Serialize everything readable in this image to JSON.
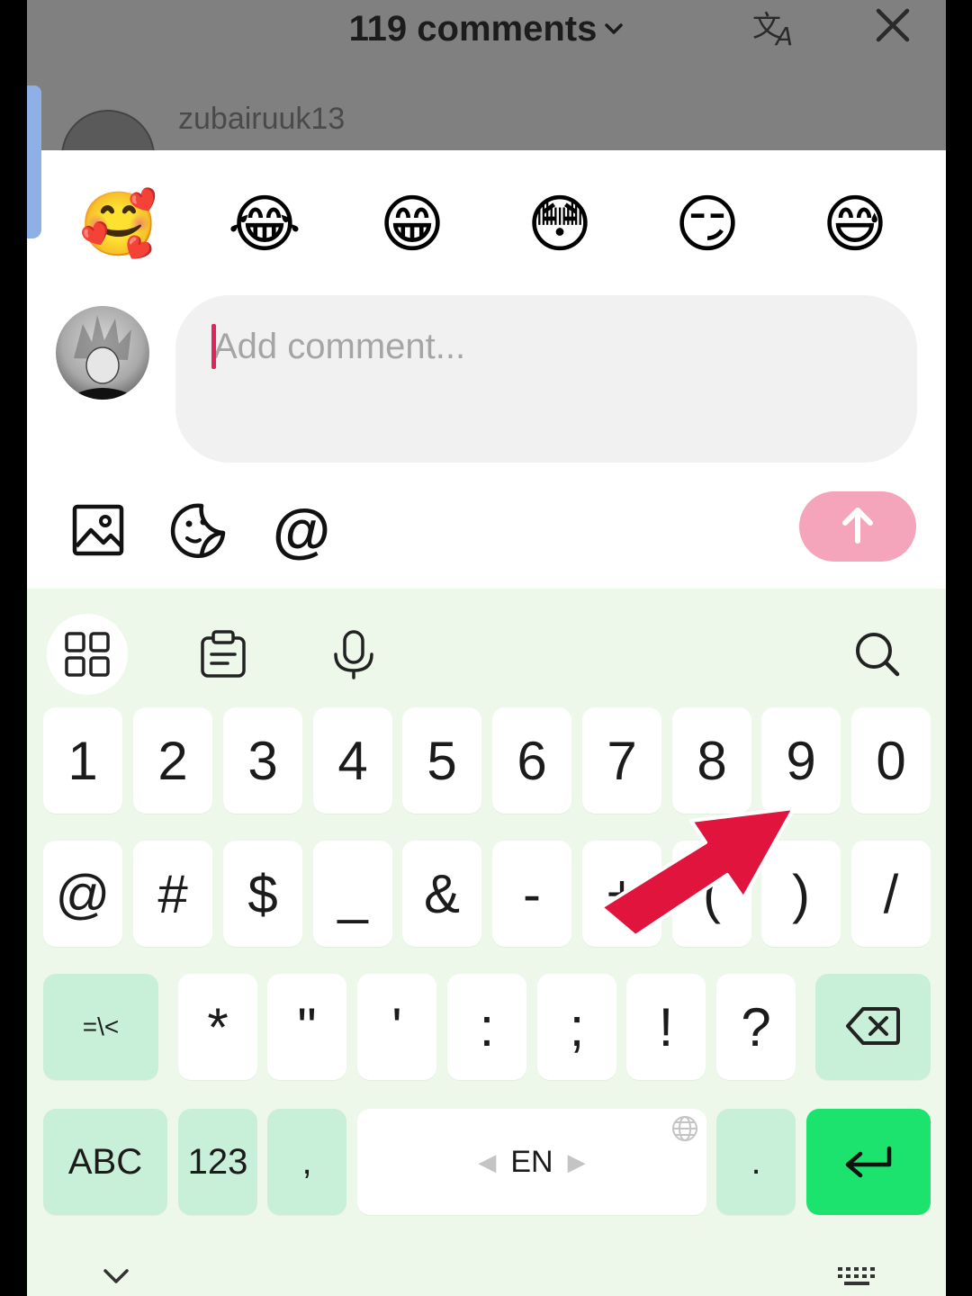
{
  "header": {
    "title": "119 comments",
    "peek_username": "zubairuuk13"
  },
  "emojis": [
    "🥰",
    "😂",
    "😁",
    "😳",
    "😏",
    "😅"
  ],
  "comment": {
    "placeholder": "Add comment...",
    "value": ""
  },
  "toolbar": {
    "mention_label": "@"
  },
  "keyboard": {
    "row1": [
      "1",
      "2",
      "3",
      "4",
      "5",
      "6",
      "7",
      "8",
      "9",
      "0"
    ],
    "row2": [
      "@",
      "#",
      "$",
      "_",
      "&",
      "-",
      "+",
      "(",
      ")",
      "/"
    ],
    "row3_left": "=\\<",
    "row3": [
      "*",
      "\"",
      "'",
      ":",
      ";",
      "!",
      "?"
    ],
    "abc_label": "ABC",
    "num_label": "123",
    "comma": ",",
    "space_label": "EN",
    "period": "."
  },
  "colors": {
    "send_button": "#f4a5bb",
    "caret": "#e0245e",
    "enter_key": "#1be36d",
    "fn_key": "#c8efd7",
    "keyboard_bg": "#eef8ea",
    "annotation_arrow": "#e0143c"
  },
  "icons": {
    "translate": "translate-icon",
    "close": "close-icon",
    "image": "image-icon",
    "sticker": "sticker-icon",
    "send": "arrow-up-icon",
    "apps": "apps-grid-icon",
    "clipboard": "clipboard-icon",
    "mic": "microphone-icon",
    "search": "search-icon",
    "backspace": "backspace-icon",
    "enter": "enter-icon",
    "hide_keyboard": "chevron-down-icon",
    "keyboard_switch": "keyboard-icon"
  }
}
